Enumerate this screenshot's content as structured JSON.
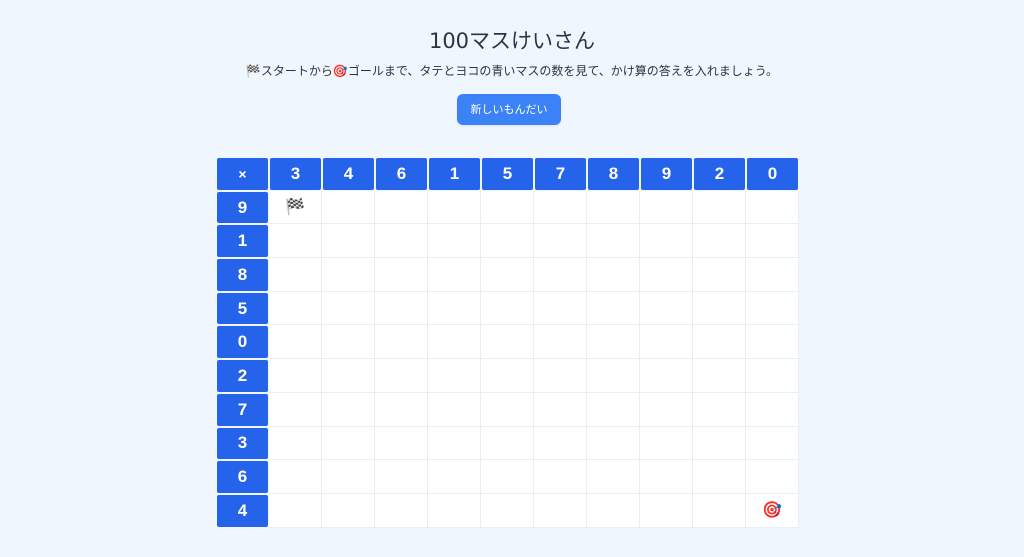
{
  "title": "100マスけいさん",
  "instructions": {
    "start_icon": "🏁",
    "part1": "スタートから",
    "goal_icon": "🎯",
    "part2": "ゴールまで、タテとヨコの青いマスの数を見て、かけ算の答えを入れましょう。"
  },
  "new_button_label": "新しいもんだい",
  "grid": {
    "corner": "×",
    "column_headers": [
      "3",
      "4",
      "6",
      "1",
      "5",
      "7",
      "8",
      "9",
      "2",
      "0"
    ],
    "row_headers": [
      "9",
      "1",
      "8",
      "5",
      "0",
      "2",
      "7",
      "3",
      "6",
      "4"
    ],
    "start_marker": "🏁",
    "goal_marker": "🎯",
    "start_position": {
      "row": 0,
      "col": 0
    },
    "goal_position": {
      "row": 9,
      "col": 9
    }
  },
  "colors": {
    "background": "#eff6fd",
    "header_blue": "#2563eb",
    "button_blue": "#3b82f6"
  }
}
